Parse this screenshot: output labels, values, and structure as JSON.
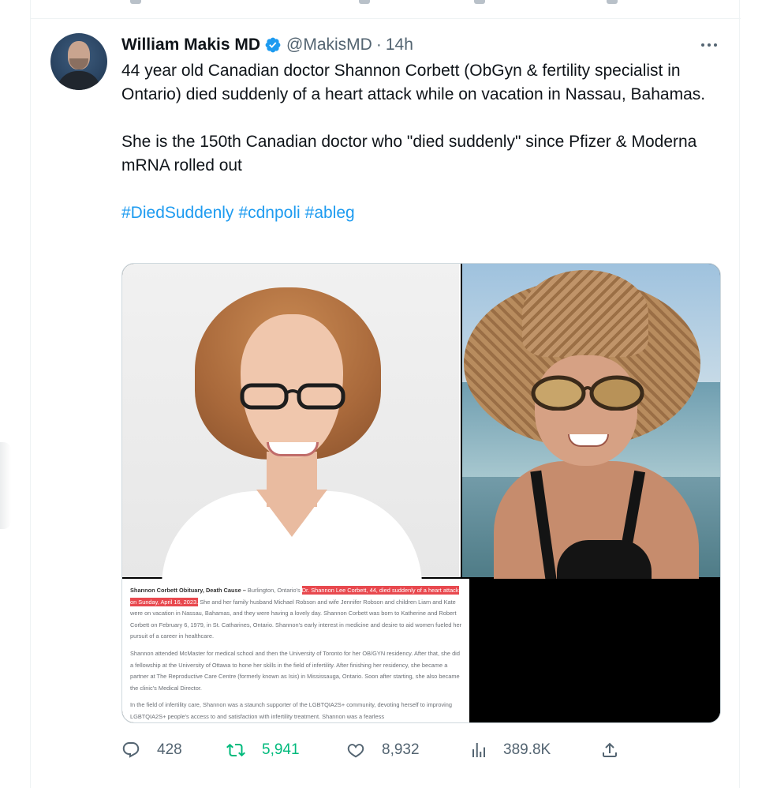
{
  "tweet": {
    "author": {
      "display_name": "William Makis MD",
      "handle": "@MakisMD",
      "separator": "·",
      "time": "14h"
    },
    "body": {
      "paragraph_1": "44 year old Canadian doctor Shannon Corbett (ObGyn & fertility specialist in Ontario) died suddenly of a heart attack while on vacation in Nassau, Bahamas.",
      "paragraph_2": "She is the 150th Canadian doctor who \"died suddenly\" since Pfizer & Moderna mRNA rolled out",
      "hashtags": [
        "#DiedSuddenly",
        "#cdnpoli",
        "#ableg"
      ]
    },
    "media": {
      "document_excerpt": {
        "p1_lead": "Shannon Corbett Obituary, Death Cause –",
        "p1_pre": " Burlington, Ontario's ",
        "p1_highlight": "Dr. Shannon Lee Corbett, 44, died suddenly of a heart attack on Sunday, April 16, 2023.",
        "p1_rest": " She and her family husband Michael Robson and wife Jennifer Robson and children Liam and Kate were on vacation in Nassau, Bahamas, and they were having a lovely day. Shannon Corbett was born to Katherine and Robert Corbett on February 6, 1979, in St. Catharines, Ontario. Shannon's early interest in medicine and desire to aid women fueled her pursuit of a career in healthcare.",
        "p2": "Shannon attended McMaster for medical school and then the University of Toronto for her OB/GYN residency. After that, she did a fellowship at the University of Ottawa to hone her skills in the field of infertility. After finishing her residency, she became a partner at The Reproductive Care Centre (formerly known as Isis) in Mississauga, Ontario. Soon after starting, she also became the clinic's Medical Director.",
        "p3": "In the field of infertility care, Shannon was a staunch supporter of the LGBTQIA2S+ community, devoting herself to improving LGBTQIA2S+ people's access to and satisfaction with infertility treatment. Shannon was a fearless"
      }
    },
    "actions": {
      "replies": "428",
      "retweets": "5,941",
      "likes": "8,932",
      "views": "389.8K"
    }
  },
  "icons": {
    "verified": "verified-badge-icon",
    "more": "more-options-icon",
    "reply": "reply-icon",
    "retweet": "retweet-icon",
    "like": "heart-icon",
    "views": "views-chart-icon",
    "share": "share-icon"
  },
  "colors": {
    "link": "#1d9bf0",
    "retweet_active": "#00ba7c",
    "muted": "#536471",
    "highlight": "#e8484e"
  }
}
